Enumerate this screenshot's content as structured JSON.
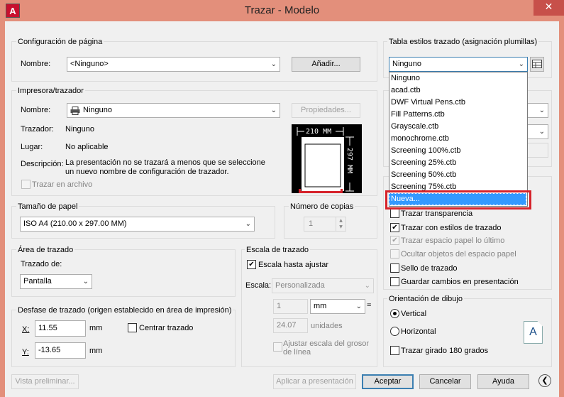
{
  "window": {
    "title": "Trazar - Modelo",
    "close_glyph": "✕",
    "icon_letter": "A"
  },
  "page_setup": {
    "group_label": "Configuración de página",
    "name_label": "Nombre:",
    "name_value": "<Ninguno>",
    "add_button": "Añadir..."
  },
  "printer": {
    "group_label": "Impresora/trazador",
    "name_label": "Nombre:",
    "name_value": "Ninguno",
    "properties_button": "Propiedades...",
    "plotter_label": "Trazador:",
    "plotter_value": "Ninguno",
    "location_label": "Lugar:",
    "location_value": "No aplicable",
    "description_label": "Descripción:",
    "description_line1": "La presentación no se trazará a menos que se seleccione",
    "description_line2": "un nuevo nombre de configuración de trazador.",
    "plot_to_file_label": "Trazar en archivo",
    "preview_width": "210 MM",
    "preview_height": "297 MM"
  },
  "paper_size": {
    "group_label": "Tamaño de papel",
    "value": "ISO A4 (210.00 x 297.00 MM)"
  },
  "copies": {
    "group_label": "Número de copias",
    "value": "1"
  },
  "plot_area": {
    "group_label": "Área de trazado",
    "what_label": "Trazado de:",
    "what_value": "Pantalla"
  },
  "plot_offset": {
    "group_label": "Desfase de trazado (origen establecido en área de impresión)",
    "x_label": "X:",
    "x_value": "11.55",
    "x_unit": "mm",
    "y_label": "Y:",
    "y_value": "-13.65",
    "y_unit": "mm",
    "center_label": "Centrar trazado"
  },
  "plot_scale": {
    "group_label": "Escala de trazado",
    "fit_label": "Escala hasta ajustar",
    "fit_checked": "✔",
    "scale_label": "Escala:",
    "scale_value": "Personalizada",
    "numerator": "1",
    "units_value": "mm",
    "equals": "=",
    "denominator": "24.07",
    "denominator_unit": "unidades",
    "lineweights_line1": "Ajustar escala del grosor",
    "lineweights_line2": "de línea"
  },
  "style_table": {
    "group_label": "Tabla estilos trazado (asignación plumillas)",
    "value": "Ninguno",
    "items": [
      "Ninguno",
      "acad.ctb",
      "DWF Virtual Pens.ctb",
      "Fill Patterns.ctb",
      "Grayscale.ctb",
      "monochrome.ctb",
      "Screening 100%.ctb",
      "Screening 25%.ctb",
      "Screening 50%.ctb",
      "Screening 75%.ctb"
    ],
    "new_item": "Nueva..."
  },
  "plot_options": {
    "transparency": "Trazar transparencia",
    "with_styles": "Trazar con estilos de trazado",
    "paperspace_last": "Trazar espacio papel lo último",
    "hide_objects": "Ocultar objetos del espacio papel",
    "stamp": "Sello de trazado",
    "save_changes": "Guardar cambios en presentación",
    "check": "✔"
  },
  "orientation": {
    "group_label": "Orientación de dibujo",
    "portrait": "Vertical",
    "landscape": "Horizontal",
    "upside_down": "Trazar girado 180 grados",
    "paper_letter": "A"
  },
  "footer": {
    "preview": "Vista preliminar...",
    "apply": "Aplicar a presentación",
    "ok": "Aceptar",
    "cancel": "Cancelar",
    "help": "Ayuda",
    "collapse_glyph": "❮"
  }
}
